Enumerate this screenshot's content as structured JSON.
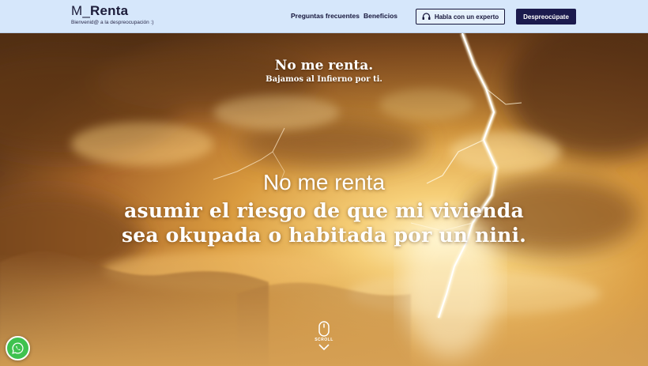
{
  "header": {
    "logo_prefix": "M_",
    "logo_main": "Renta",
    "logo_tagline": "Bienvenid@ a la despreocupación :)",
    "nav": {
      "faq_label": "Preguntas frecuentes",
      "benefits_label": "Beneficios"
    },
    "expert_button_label": "Habla con un experto",
    "cta_button_label": "Despreocúpate"
  },
  "hero": {
    "top_title": "No me renta.",
    "top_subtitle": "Bajamos al Infierno por ti.",
    "line1": "No me renta",
    "line2": "asumir el riesgo de que mi vivienda",
    "line3": "sea okupada o habitada por un nini.",
    "scroll_label": "SCROLL"
  },
  "colors": {
    "header_bg": "#d6e7fb",
    "brand_navy": "#1b1a4d",
    "whatsapp_green": "#3ec24f"
  },
  "icons": {
    "expert_button_icon": "headset-icon",
    "scroll_icon": "mouse-icon",
    "scroll_arrow": "chevron-down-icon",
    "chat_button_icon": "whatsapp-icon"
  }
}
